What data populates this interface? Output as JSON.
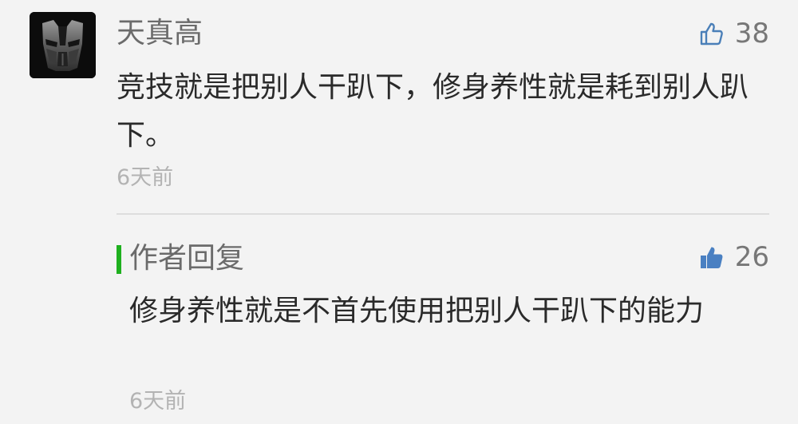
{
  "comment": {
    "username": "天真高",
    "likes": "38",
    "text": "竞技就是把别人干趴下，修身养性就是耗到别人趴下。",
    "time": "6天前",
    "avatar_icon": "transformers-autobot-mask-avatar"
  },
  "author_reply": {
    "label": "作者回复",
    "likes": "26",
    "text": "修身养性就是不首先使用把别人干趴下的能力",
    "time": "6天前"
  },
  "colors": {
    "background": "#f3f3f3",
    "reply_accent": "#1fb01f",
    "like_outline": "#4a7fb8",
    "like_filled": "#4a80c2"
  }
}
